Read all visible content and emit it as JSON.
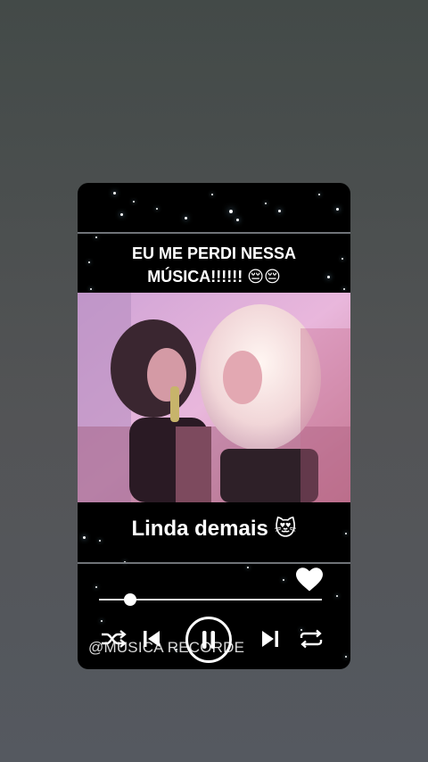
{
  "post": {
    "top_caption_line1": "EU ME PERDI NESSA",
    "top_caption_line2": "MÚSICA!!!!!! 😔😔",
    "bottom_caption": "Linda demais 😻",
    "watermark": "@MUSICA RECORDE"
  },
  "player": {
    "progress": 0.14,
    "liked": true,
    "controls": [
      "shuffle-icon",
      "previous-icon",
      "pause-icon",
      "next-icon",
      "repeat-icon"
    ]
  },
  "colors": {
    "background": "#4d5253",
    "card": "#000000",
    "text": "#ffffff",
    "video_tint": "#d9a6d6"
  }
}
